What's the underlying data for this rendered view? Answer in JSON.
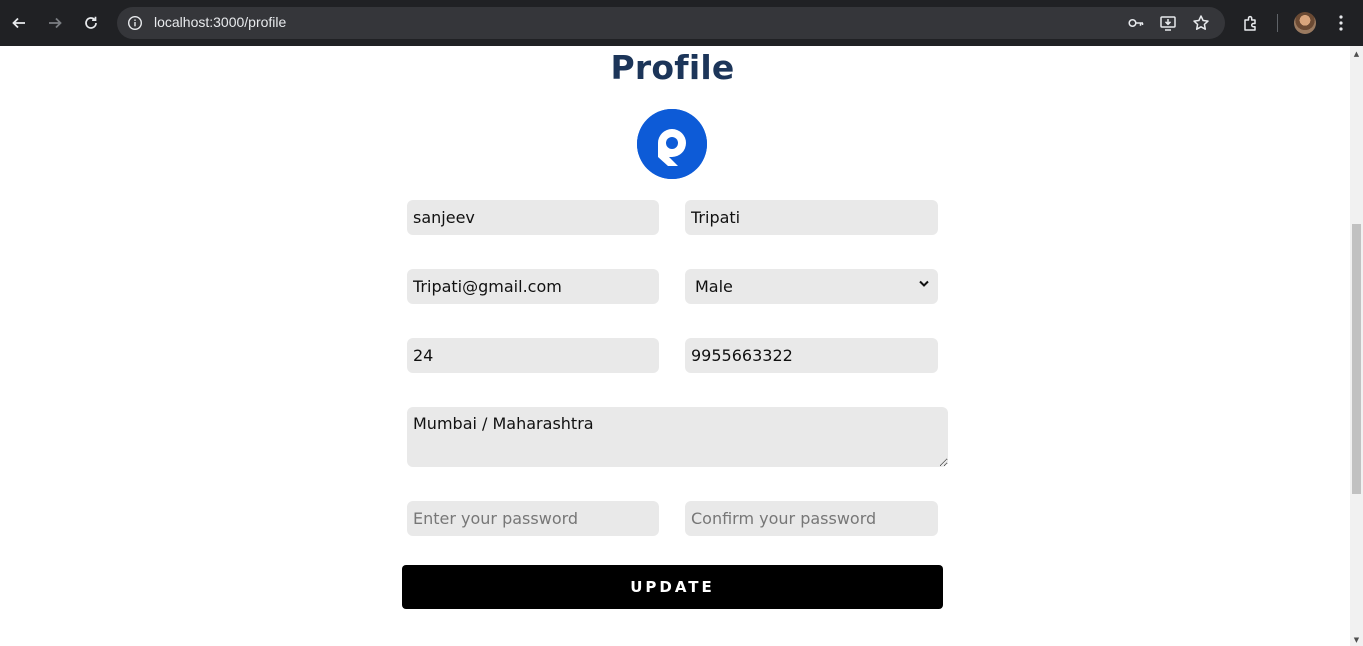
{
  "browser": {
    "url": "localhost:3000/profile"
  },
  "page": {
    "title": "Profile",
    "logo_icon": "round-p-logo"
  },
  "form": {
    "first_name": "sanjeev",
    "last_name": "Tripati",
    "email": "Tripati@gmail.com",
    "gender": {
      "selected": "Male",
      "options": [
        "Male"
      ]
    },
    "age": "24",
    "phone": "9955663322",
    "address": "Mumbai / Maharashtra",
    "password_placeholder": "Enter your password",
    "confirm_password_placeholder": "Confirm your password",
    "submit_label": "UPDATE"
  },
  "colors": {
    "title": "#1c3559",
    "logo": "#0d5bd7",
    "field_bg": "#e9e9e9",
    "button_bg": "#000000"
  }
}
